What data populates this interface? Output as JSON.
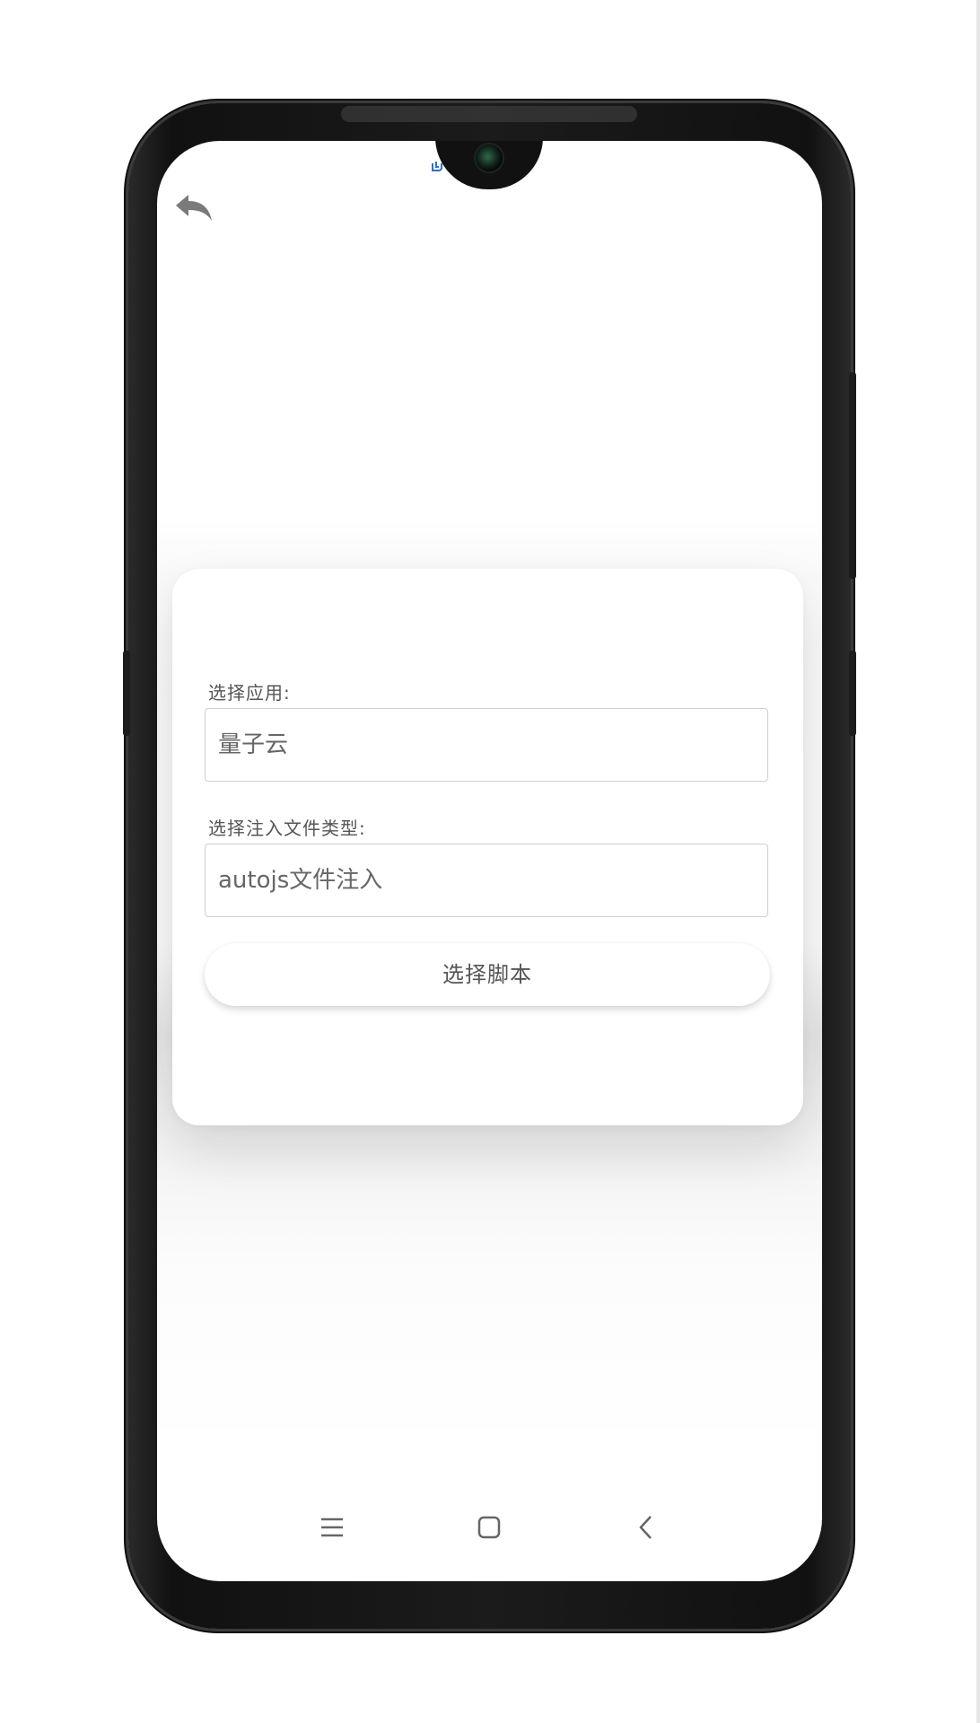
{
  "form": {
    "app_label": "选择应用:",
    "app_value": "量子云",
    "type_label": "选择注入文件类型:",
    "type_value": "autojs文件注入",
    "script_button_label": "选择脚本"
  },
  "status_bar": {
    "notification_icon": "app-notification-icon"
  },
  "nav": {
    "back_icon": "reply-arrow-icon",
    "menu_icon": "menu-icon",
    "home_icon": "home-icon",
    "system_back_icon": "chevron-left-icon"
  },
  "colors": {
    "text_primary": "#555555",
    "text_value": "#666666",
    "border": "#cfcfcf",
    "notification_blue": "#2f6fd0"
  }
}
